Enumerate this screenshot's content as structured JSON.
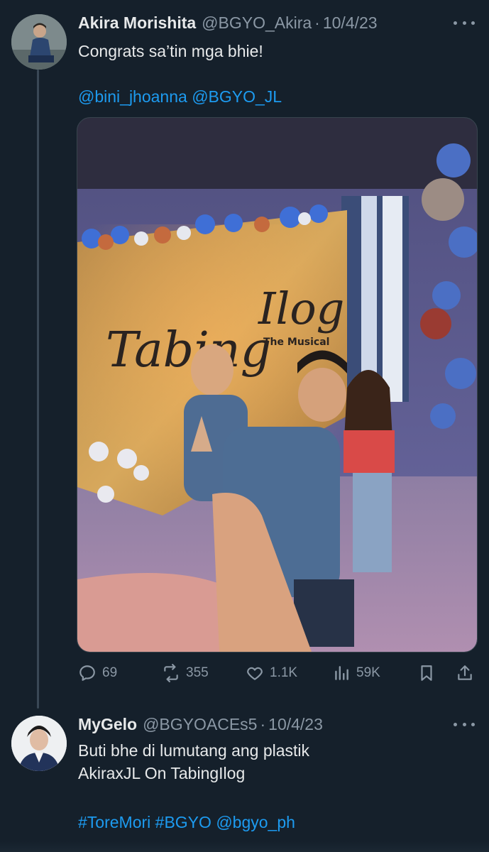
{
  "tweet1": {
    "name": "Akira Morishita",
    "handle": "@BGYO_Akira",
    "separator": "·",
    "date": "10/4/23",
    "text_line1": "Congrats sa’tin mga bhie!",
    "mention1": "@bini_jhoanna",
    "mention2": "@BGYO_JL",
    "media_sign": "Tabing Ilog",
    "media_sign_sub": "The Musical",
    "stats": {
      "replies": "69",
      "reposts": "355",
      "likes": "1.1K",
      "views": "59K"
    }
  },
  "tweet2": {
    "name": "MyGelo",
    "handle": "@BGYOACEs5",
    "separator": "·",
    "date": "10/4/23",
    "text_line1": "Buti bhe di lumutang ang plastik",
    "text_line2": "AkiraxJL On TabingIlog",
    "hashtag1": "#ToreMori",
    "hashtag2": "#BGYO",
    "mention1": "@bgyo_ph"
  },
  "icons": {
    "reply": "reply-icon",
    "repost": "repost-icon",
    "like": "heart-icon",
    "views": "views-icon",
    "bookmark": "bookmark-icon",
    "share": "share-icon",
    "more": "more-icon"
  },
  "colors": {
    "background": "#15202b",
    "text": "#e7e9ea",
    "muted": "#8b98a5",
    "link": "#1d9bf0"
  }
}
